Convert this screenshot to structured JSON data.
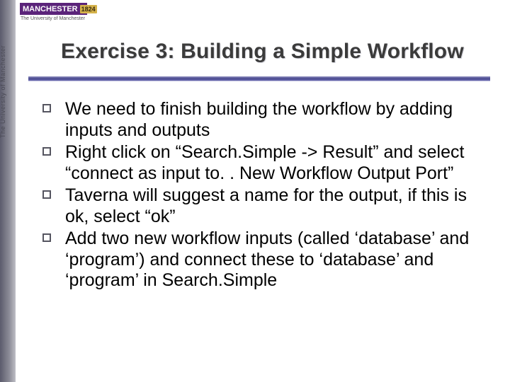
{
  "brand": {
    "name": "MANCHESTER",
    "year": "1824",
    "subtitle": "The University of Manchester"
  },
  "sidebar_text": "The University of Manchester",
  "title": "Exercise 3: Building a Simple Workflow",
  "bullets": [
    "We need to finish building the workflow by adding inputs and outputs",
    "Right click on “Search.Simple -> Result” and select “connect as input to. . New Workflow Output Port”",
    "Taverna will suggest a name for the output, if this is ok, select “ok”",
    "Add two new workflow inputs (called ‘database’ and ‘program’) and connect these to ‘database’ and ‘program’ in Search.Simple"
  ]
}
